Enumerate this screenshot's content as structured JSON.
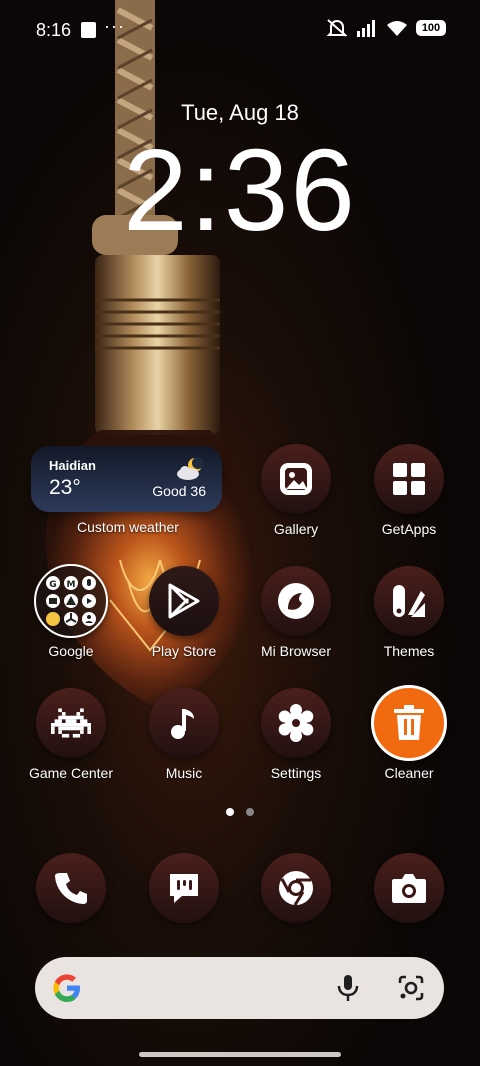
{
  "status_bar": {
    "time": "8:16",
    "more_indicator": "···",
    "battery": "100",
    "icons": [
      "notifications-muted-icon",
      "signal-icon",
      "wifi-icon",
      "battery-icon"
    ]
  },
  "lockclock": {
    "date": "Tue, Aug 18",
    "time": "2:36"
  },
  "weather_widget": {
    "city": "Haidian",
    "temp": "23°",
    "aqi": "Good 36",
    "label": "Custom weather",
    "icon": "partly-cloudy-night-icon"
  },
  "apps": [
    {
      "label": "Gallery",
      "icon": "gallery-icon"
    },
    {
      "label": "GetApps",
      "icon": "getapps-icon"
    },
    {
      "label": "Google",
      "icon": "google-folder-icon"
    },
    {
      "label": "Play Store",
      "icon": "play-store-icon"
    },
    {
      "label": "Mi Browser",
      "icon": "mi-browser-icon"
    },
    {
      "label": "Themes",
      "icon": "themes-icon"
    },
    {
      "label": "Game Center",
      "icon": "game-center-icon"
    },
    {
      "label": "Music",
      "icon": "music-icon"
    },
    {
      "label": "Settings",
      "icon": "settings-icon"
    },
    {
      "label": "Cleaner",
      "icon": "cleaner-icon"
    }
  ],
  "google_folder_glyphs": [
    "G",
    "M"
  ],
  "page_indicator": {
    "pages": 2,
    "current": 1
  },
  "dock": [
    {
      "name": "Phone",
      "icon": "phone-icon"
    },
    {
      "name": "Messages",
      "icon": "messages-icon"
    },
    {
      "name": "Chrome",
      "icon": "chrome-icon"
    },
    {
      "name": "Camera",
      "icon": "camera-icon"
    }
  ],
  "search_bar": {
    "icons": [
      "google-g-icon",
      "mic-icon",
      "lens-icon"
    ]
  },
  "colors": {
    "icon_tile": "#4a1f1b",
    "cleaner_accent": "#f26a10",
    "search_bg": "#e9e3e1"
  }
}
